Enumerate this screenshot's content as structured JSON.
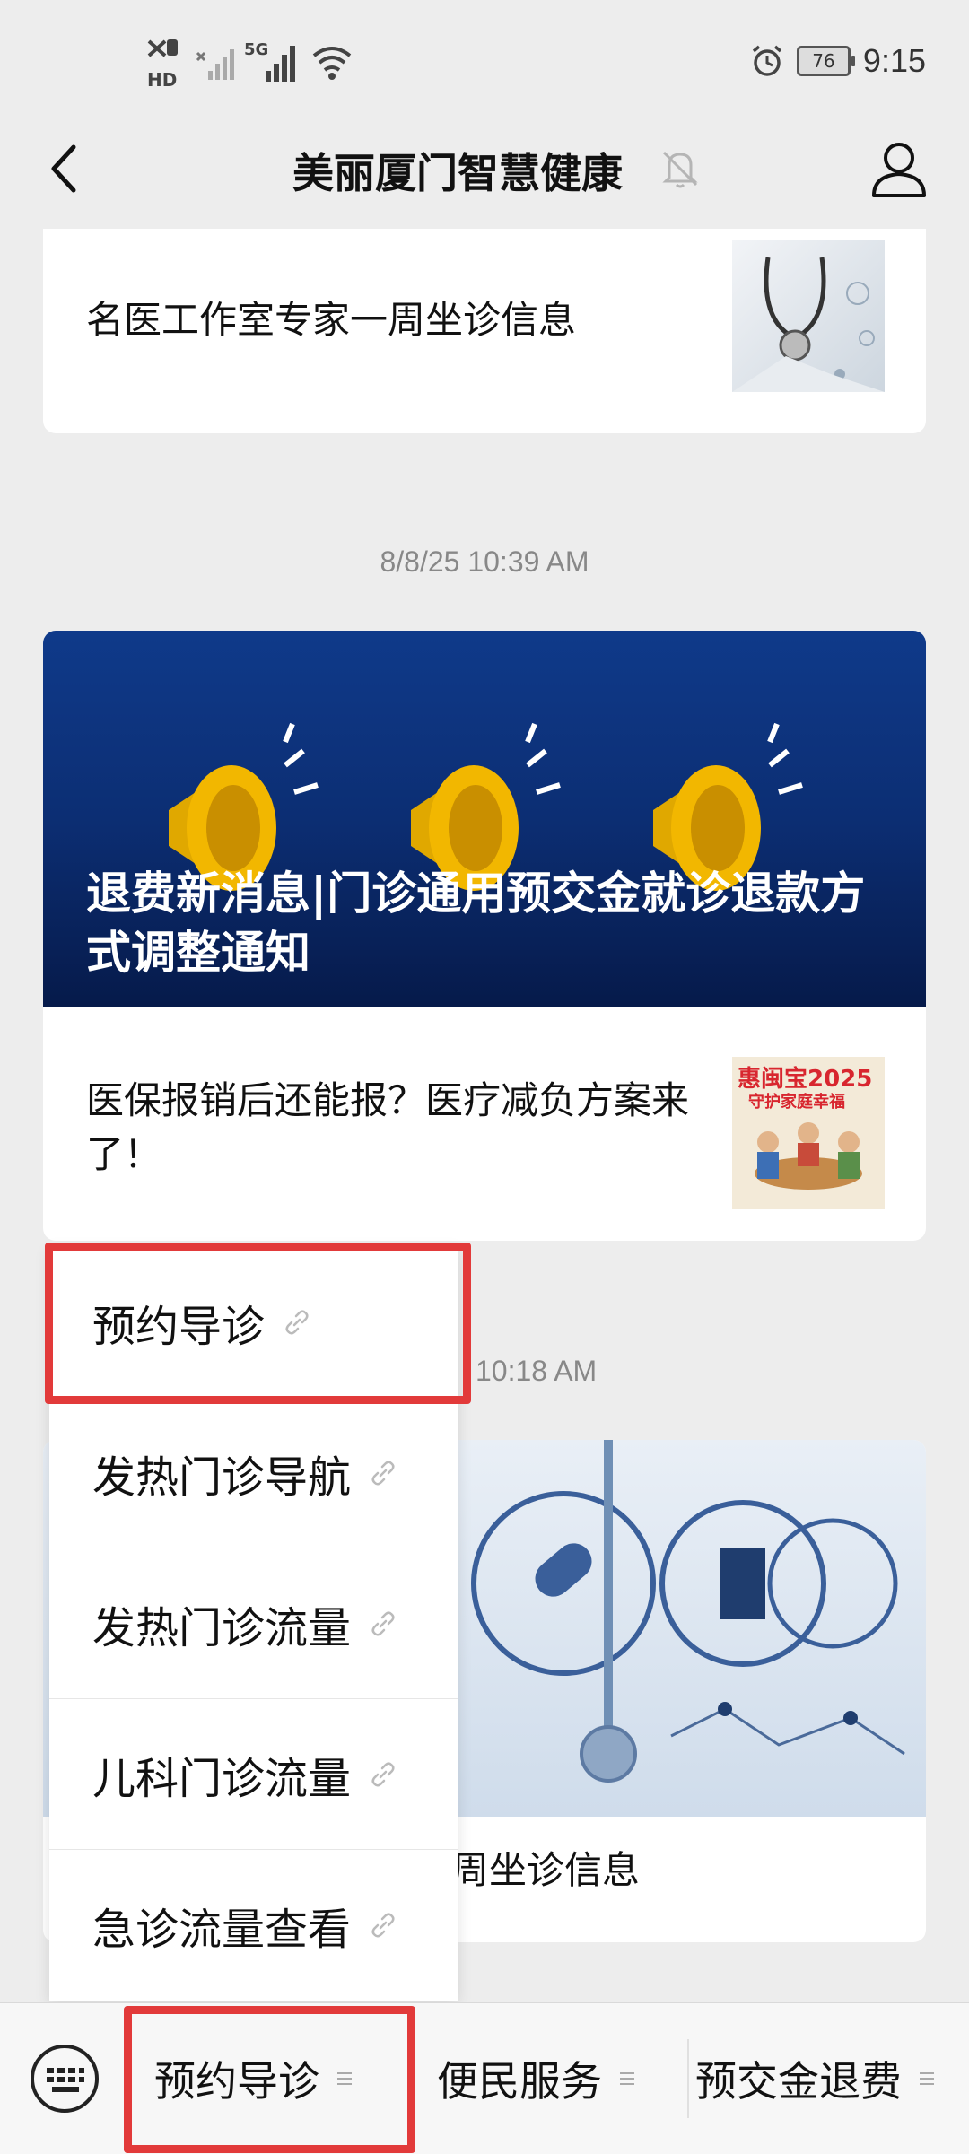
{
  "status_bar": {
    "time": "9:15",
    "battery": "76",
    "network_label": "5G",
    "hd_label": "HD"
  },
  "nav": {
    "title": "美丽厦门智慧健康"
  },
  "feed": {
    "top_card_text": "名医工作室专家一周坐诊信息",
    "timestamp_1": "8/8/25 10:39 AM",
    "banner_title": "退费新消息|门诊通用预交金就诊退款方式调整通知",
    "article_text": "医保报销后还能报？医疗减负方案来了！",
    "article_thumb_badge_line1": "惠闽宝2025",
    "article_thumb_badge_line2": "守护家庭幸福",
    "timestamp_2_partial": "10:18 AM",
    "bottom_card_text_partial": "周坐诊信息"
  },
  "popup_menu": {
    "items": [
      {
        "label": "预约导诊"
      },
      {
        "label": "发热门诊导航"
      },
      {
        "label": "发热门诊流量"
      },
      {
        "label": "儿科门诊流量"
      },
      {
        "label": "急诊流量查看"
      }
    ]
  },
  "bottom_tabs": [
    {
      "label": "预约导诊"
    },
    {
      "label": "便民服务"
    },
    {
      "label": "预交金退费"
    }
  ],
  "colors": {
    "highlight": "#e23a3a",
    "banner": "#0c2e73"
  }
}
